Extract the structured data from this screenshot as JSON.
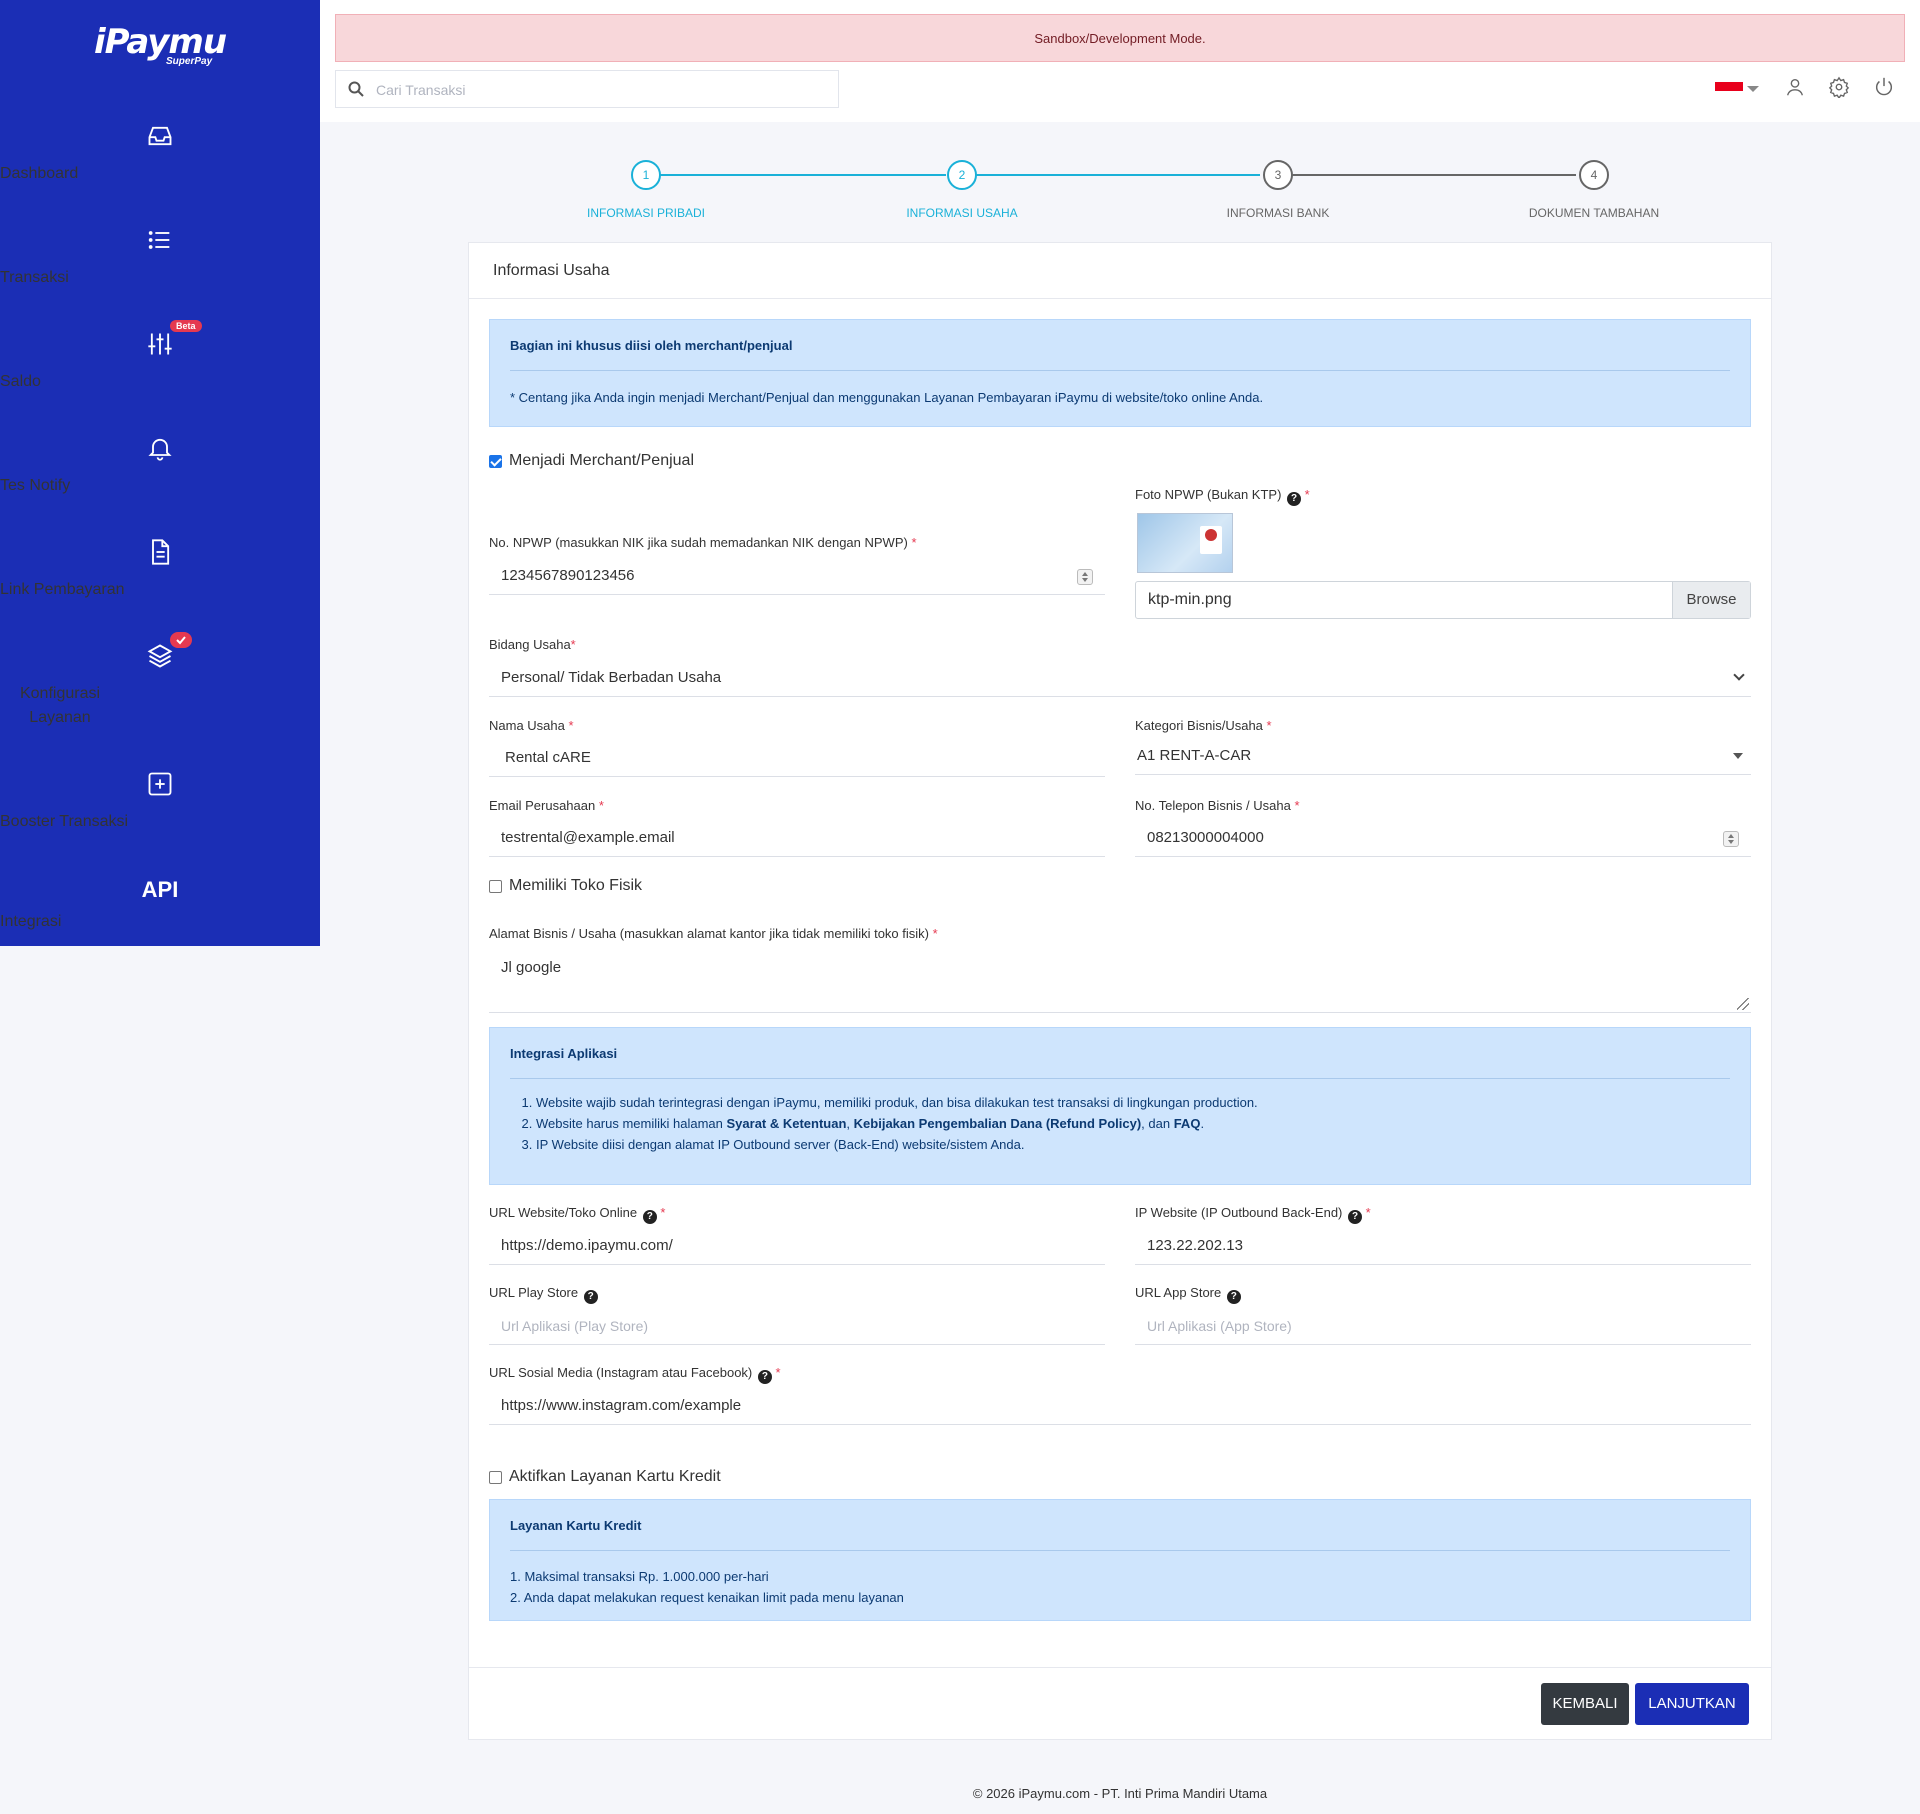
{
  "brand": {
    "name": "iPaymu",
    "sub": "SuperPay"
  },
  "nav": [
    {
      "label": "Dashboard",
      "icon": "inbox-icon"
    },
    {
      "label": "Transaksi",
      "icon": "list-icon"
    },
    {
      "label": "Saldo",
      "icon": "sliders-icon",
      "badge": "Beta"
    },
    {
      "label": "Tes Notify",
      "icon": "bell-icon"
    },
    {
      "label": "Link Pembayaran",
      "icon": "file-text-icon"
    },
    {
      "label": "Konfigurasi Layanan",
      "icon": "layers-icon",
      "badge": "check"
    },
    {
      "label": "Booster Transaksi",
      "icon": "plus-square-icon"
    },
    {
      "label": "Integrasi",
      "icon": "api-icon",
      "icon_text": "API"
    }
  ],
  "topbar": {
    "sandbox_text": "Sandbox/Development Mode.",
    "search_placeholder": "Cari Transaksi"
  },
  "stepper": [
    {
      "num": "1",
      "label": "INFORMASI PRIBADI",
      "active": true
    },
    {
      "num": "2",
      "label": "INFORMASI USAHA",
      "active": true
    },
    {
      "num": "3",
      "label": "INFORMASI BANK",
      "active": false
    },
    {
      "num": "4",
      "label": "DOKUMEN TAMBAHAN",
      "active": false
    }
  ],
  "card": {
    "title": "Informasi Usaha",
    "merchant_info": {
      "title": "Bagian ini khusus diisi oleh merchant/penjual",
      "text": "* Centang jika Anda ingin menjadi Merchant/Penjual dan menggunakan Layanan Pembayaran iPaymu di website/toko online Anda."
    },
    "merchant_checkbox": {
      "label": "Menjadi Merchant/Penjual",
      "checked": true
    },
    "foto_npwp": {
      "label": "Foto NPWP (Bukan KTP)",
      "file_name": "ktp-min.png",
      "browse_label": "Browse"
    },
    "npwp": {
      "label": "No. NPWP (masukkan NIK jika sudah memadankan NIK dengan NPWP)",
      "value": "1234567890123456"
    },
    "bidang_usaha": {
      "label": "Bidang Usaha",
      "value": "Personal/ Tidak Berbadan Usaha"
    },
    "nama_usaha": {
      "label": "Nama Usaha",
      "value": "Rental cARE"
    },
    "kategori": {
      "label": "Kategori Bisnis/Usaha",
      "value": "A1 RENT-A-CAR"
    },
    "email": {
      "label": "Email Perusahaan",
      "value": "testrental@example.email"
    },
    "telepon": {
      "label": "No. Telepon Bisnis / Usaha",
      "value": "08213000004000"
    },
    "toko_fisik": {
      "label": "Memiliki Toko Fisik",
      "checked": false
    },
    "alamat": {
      "label": "Alamat Bisnis / Usaha (masukkan alamat kantor jika tidak memiliki toko fisik)",
      "value": "Jl google"
    },
    "integrasi_info": {
      "title": "Integrasi Aplikasi",
      "item1": "Website wajib sudah terintegrasi dengan iPaymu, memiliki produk, dan bisa dilakukan test transaksi di lingkungan production.",
      "item2_a": "Website harus memiliki halaman ",
      "item2_b": "Syarat & Ketentuan",
      "item2_c": ", ",
      "item2_d": "Kebijakan Pengembalian Dana (Refund Policy)",
      "item2_e": ", dan ",
      "item2_f": "FAQ",
      "item2_g": ".",
      "item3": "IP Website diisi dengan alamat IP Outbound server (Back-End) website/sistem Anda."
    },
    "url_website": {
      "label": "URL Website/Toko Online",
      "value": "https://demo.ipaymu.com/"
    },
    "ip_website": {
      "label": "IP Website (IP Outbound Back-End)",
      "value": "123.22.202.13"
    },
    "url_play": {
      "label": "URL Play Store",
      "placeholder": "Url Aplikasi (Play Store)"
    },
    "url_app": {
      "label": "URL App Store",
      "placeholder": "Url Aplikasi (App Store)"
    },
    "url_sosmed": {
      "label": "URL Sosial Media (Instagram atau Facebook)",
      "value": "https://www.instagram.com/example"
    },
    "kartu_kredit": {
      "label": "Aktifkan Layanan Kartu Kredit",
      "checked": false
    },
    "kredit_info": {
      "title": "Layanan Kartu Kredit",
      "item1": "Maksimal transaksi Rp. 1.000.000 per-hari",
      "item2": "Anda dapat melakukan request kenaikan limit pada menu layanan"
    },
    "btn_back": "KEMBALI",
    "btn_next": "LANJUTKAN"
  },
  "footer": "© 2026 iPaymu.com - PT. Inti Prima Mandiri Utama",
  "colors": {
    "sidebar": "#1b2eb5",
    "accent": "#1ab1d8",
    "primary_btn": "#1b2eb5",
    "dark_btn": "#343a40",
    "info_bg": "#cfe5fd"
  }
}
